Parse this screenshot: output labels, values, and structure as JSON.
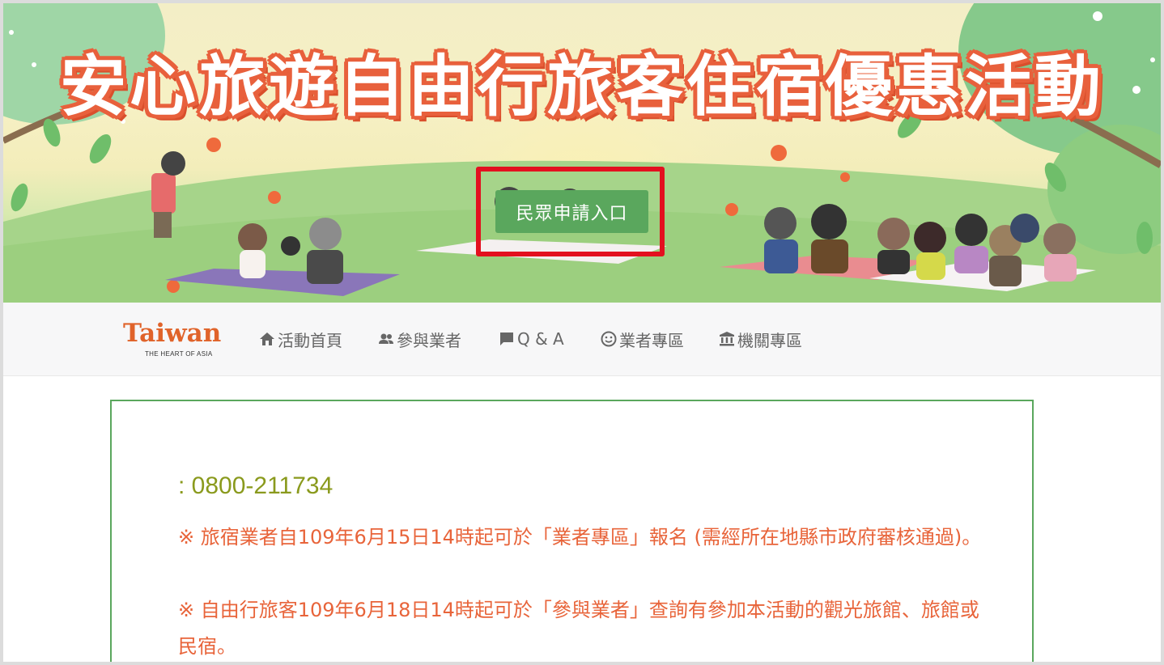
{
  "banner": {
    "title": "安心旅遊自由行旅客住宿優惠活動",
    "apply_button": "民眾申請入口"
  },
  "brand": {
    "name": "Taiwan",
    "tagline": "THE HEART OF ASIA"
  },
  "nav": {
    "items": [
      {
        "label": "活動首頁",
        "icon": "home-icon"
      },
      {
        "label": "參與業者",
        "icon": "users-icon"
      },
      {
        "label": "Q & A",
        "icon": "comment-icon"
      },
      {
        "label": "業者專區",
        "icon": "smile-icon"
      },
      {
        "label": "機關專區",
        "icon": "institution-icon"
      }
    ]
  },
  "content": {
    "phone": ": 0800-211734",
    "notice_1": "※ 旅宿業者自109年6月15日14時起可於「業者專區」報名 (需經所在地縣市政府審核通過)。",
    "notice_2": "※ 自由行旅客109年6月18日14時起可於「參與業者」查詢有參加本活動的觀光旅館、旅館或民宿。"
  },
  "colors": {
    "accent_green": "#5aa75d",
    "highlight_red": "#e3101f",
    "title_orange": "#e8603c",
    "notice_orange": "#e8643a",
    "phone_olive": "#8a9a1d"
  }
}
